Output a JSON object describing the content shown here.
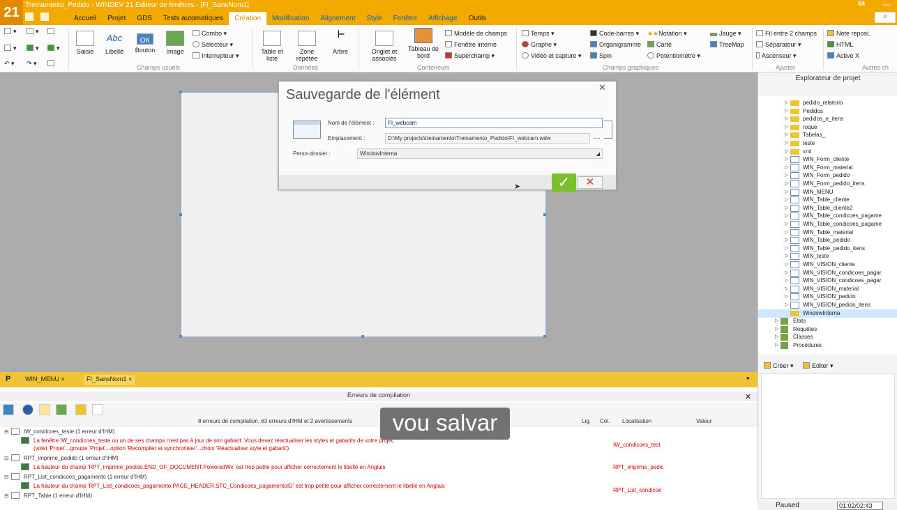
{
  "app": {
    "title": "Treinamento_Pedido - WINDEV 21  Editeur de fenêtres - [FI_SansNom1]",
    "logo": "21",
    "badge": "64",
    "menus": [
      "Accueil",
      "Projet",
      "GDS",
      "Tests automatiques",
      "Création",
      "Modification",
      "Alignement",
      "Style",
      "Fenêtre",
      "Affichage",
      "Outils"
    ],
    "active_menu": "Création"
  },
  "ribbon": {
    "champs_usuels": {
      "saisie": "Saisie",
      "libelle": "Libellé",
      "bouton": "Bouton",
      "image": "Image",
      "combo": "Combo",
      "selecteur": "Sélecteur",
      "interrupteur": "Interrupteur",
      "group": "Champs usuels",
      "abc": "Abc",
      "ok": "OK"
    },
    "donnees": {
      "table": "Table et liste",
      "zone": "Zone répétée",
      "arbre": "Arbre",
      "group": "Données"
    },
    "conteneurs": {
      "onglet": "Onglet et associés",
      "tableau": "Tableau de bord",
      "modele": "Modèle de champs",
      "fenetre": "Fenêtre interne",
      "superchamp": "Superchamp",
      "group": "Conteneurs"
    },
    "graphiques": {
      "temps": "Temps",
      "graphe": "Graphe",
      "video": "Vidéo et capture",
      "codebarres": "Code-barres",
      "organigramme": "Organigramme",
      "spin": "Spin",
      "notation": "Notation",
      "carte": "Carte",
      "potentiometre": "Potentiomètre",
      "jauge": "Jauge",
      "treemap": "TreeMap",
      "group": "Champs graphiques"
    },
    "ajuster": {
      "fil": "Fil entre 2 champs",
      "separateur": "Séparateur",
      "ascenseur": "Ascenseur",
      "group": "Ajuster"
    },
    "autres": {
      "note": "Note reposi.",
      "html": "HTML",
      "activex": "Active X",
      "group": "Autres ch"
    }
  },
  "dialog": {
    "title": "Sauvegarde de l'élément",
    "nom_label": "Nom de l'élément :",
    "nom_value": "FI_webcam",
    "empl_label": "Emplacement :",
    "empl_value": "D:\\My projects\\treinamento\\Treinamento_Pedido\\FI_webcam.wdw",
    "perso_label": "Perso-dossier :",
    "perso_value": "WindowInterna"
  },
  "explorer": {
    "title": "Explorateur de projet",
    "items": [
      {
        "label": "pedido_relatorio",
        "type": "folder"
      },
      {
        "label": "Pedidos",
        "type": "folder"
      },
      {
        "label": "pedidos_e_itens",
        "type": "folder"
      },
      {
        "label": "roque",
        "type": "folder"
      },
      {
        "label": "Tabelas_",
        "type": "folder"
      },
      {
        "label": "teste",
        "type": "folder"
      },
      {
        "label": "xml",
        "type": "folder"
      },
      {
        "label": "WIN_Form_cliente",
        "type": "win"
      },
      {
        "label": "WIN_Form_material",
        "type": "win"
      },
      {
        "label": "WIN_Form_pedido",
        "type": "win"
      },
      {
        "label": "WIN_Form_pedido_itens",
        "type": "win"
      },
      {
        "label": "WIN_MENU",
        "type": "win"
      },
      {
        "label": "WIN_Table_cliente",
        "type": "win"
      },
      {
        "label": "WIN_Table_cliente2",
        "type": "win"
      },
      {
        "label": "WIN_Table_condicoes_pagame",
        "type": "win"
      },
      {
        "label": "WIN_Table_condicoes_pagame",
        "type": "win"
      },
      {
        "label": "WIN_Table_material",
        "type": "win"
      },
      {
        "label": "WIN_Table_pedido",
        "type": "win"
      },
      {
        "label": "WIN_Table_pedido_itens",
        "type": "win"
      },
      {
        "label": "WIN_teste",
        "type": "win"
      },
      {
        "label": "WIN_VISION_cliente",
        "type": "win"
      },
      {
        "label": "WIN_VISION_condicoes_pagar",
        "type": "win"
      },
      {
        "label": "WIN_VISION_condicoes_pagar",
        "type": "win"
      },
      {
        "label": "WIN_VISION_material",
        "type": "win"
      },
      {
        "label": "WIN_VISION_pedido",
        "type": "win"
      },
      {
        "label": "WIN_VISION_pedido_itens",
        "type": "win"
      },
      {
        "label": "WindowInterna",
        "type": "folder",
        "selected": true
      },
      {
        "label": "Etats",
        "type": "etat",
        "top": true
      },
      {
        "label": "Requêtes",
        "type": "etat",
        "top": true
      },
      {
        "label": "Classes",
        "type": "etat",
        "top": true
      },
      {
        "label": "Procédures",
        "type": "etat",
        "top": true
      }
    ],
    "creer": "Créer",
    "editer": "Editer"
  },
  "tabs": [
    {
      "label": "WIN_MENU",
      "close": "×"
    },
    {
      "label": "FI_SansNom1",
      "close": "×"
    }
  ],
  "errors": {
    "title": "Erreurs de compilation",
    "summary": "8 erreurs de compilation, 63 erreurs d'IHM et 2 avertissements",
    "col_lig": "Lig.",
    "col_col": "Col.",
    "col_loc": "Localisation",
    "col_val": "Valeur",
    "rows": [
      {
        "kind": "group",
        "text": "IW_condicoes_teste (1 erreur d'IHM)"
      },
      {
        "kind": "msg",
        "text": "La fenêtre IW_condicoes_teste ou un de ses champs n'est pas à jour de son gabarit. Vous devez réactualiser les styles et gabarits de votre projet.",
        "loc": "IW_condicoes_test"
      },
      {
        "kind": "msg2",
        "text": "(volet 'Projet'...groupe 'Projet'...option 'Recompiler et synchroniser'...choix 'Réactualiser style et gabarit')"
      },
      {
        "kind": "group",
        "text": "RPT_imprime_pedido (1 erreur d'IHM)"
      },
      {
        "kind": "msg",
        "text": "La hauteur du champ 'RPT_imprime_pedido.END_OF_DOCUMENT.PoweredWx' est trop petite pour afficher correctement le libellé en Anglais",
        "loc": "RPT_imprime_pedic"
      },
      {
        "kind": "group",
        "text": "RPT_List_condicoes_pagamento (1 erreur d'IHM)"
      },
      {
        "kind": "msg",
        "text": "La hauteur du champ 'RPT_List_condicoes_pagamento.PAGE_HEADER.STC_Condicoes_pagamentoID' est trop petite pour afficher correctement le libellé en Anglais",
        "loc": "RPT_List_condicoe"
      },
      {
        "kind": "group",
        "text": "RPT_Table (1 erreur d'IHM)"
      }
    ]
  },
  "subtitle": "vou salvar",
  "status": {
    "paused": "Paused",
    "time": "01:02/02:43"
  }
}
